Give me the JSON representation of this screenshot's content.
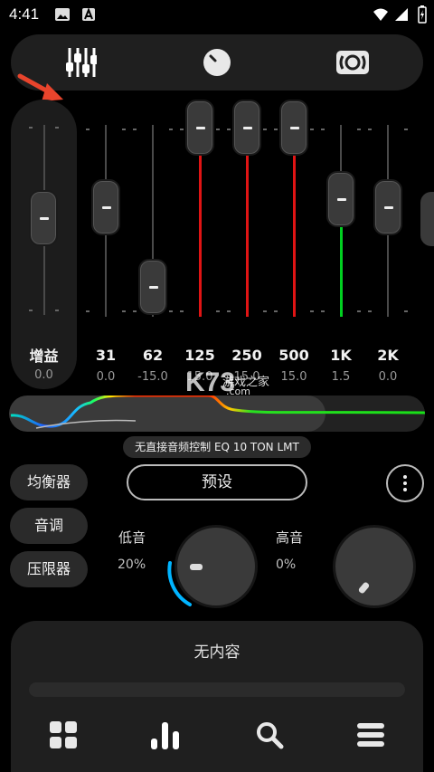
{
  "status_bar": {
    "time": "4:41"
  },
  "equalizer": {
    "gain": {
      "label": "增益",
      "value": "0.0"
    },
    "bands": [
      {
        "label": "31",
        "value": "0.0",
        "level": 0.5
      },
      {
        "label": "62",
        "value": "-15.0",
        "level": 0.0
      },
      {
        "label": "125",
        "value": "15.0",
        "level": 1.0
      },
      {
        "label": "250",
        "value": "15.0",
        "level": 1.0
      },
      {
        "label": "500",
        "value": "15.0",
        "level": 1.0
      },
      {
        "label": "1K",
        "value": "1.5",
        "level": 0.55
      },
      {
        "label": "2K",
        "value": "0.0",
        "level": 0.5
      }
    ],
    "status_text": "无直接音频控制 EQ 10 TON LMT"
  },
  "side_buttons": {
    "equalizer": "均衡器",
    "tone": "音调",
    "limiter": "压限器"
  },
  "preset": {
    "label": "预设"
  },
  "tone": {
    "bass": {
      "label": "低音",
      "value": "20%",
      "level": 0.2
    },
    "treble": {
      "label": "高音",
      "value": "0%",
      "level": 0.0
    }
  },
  "player": {
    "empty_text": "无内容"
  },
  "watermark": {
    "main": "K73",
    "sub": "游戏之家",
    "domain": ".com"
  },
  "colors": {
    "positive": "#00d020",
    "negative": "#e01414",
    "accent": "#00b4ff",
    "arrow": "#e8442c"
  }
}
